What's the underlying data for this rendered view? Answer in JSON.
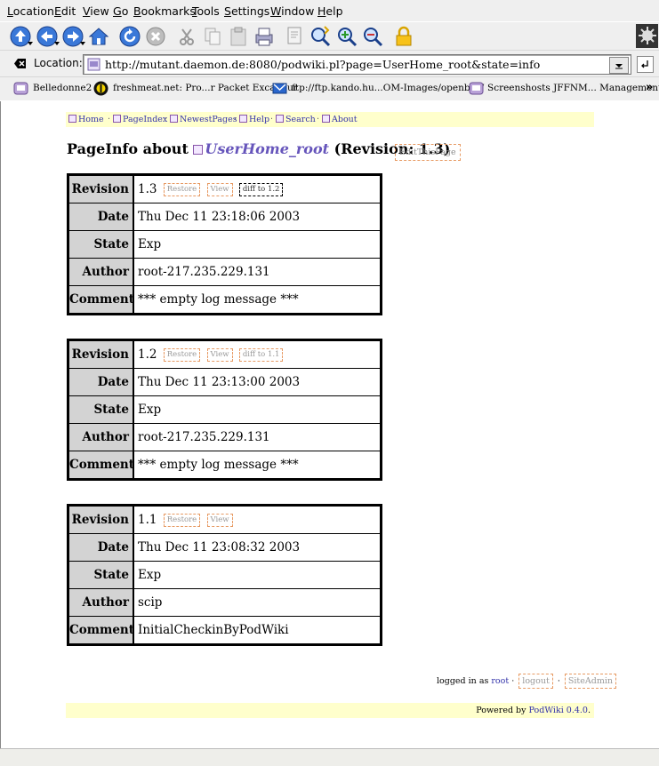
{
  "menu": [
    "Location",
    "Edit",
    "View",
    "Go",
    "Bookmarks",
    "Tools",
    "Settings",
    "Window",
    "Help"
  ],
  "location": {
    "label": "Location:",
    "url": "http://mutant.daemon.de:8080/podwiki.pl?page=UserHome_root&state=info"
  },
  "bookmarks": [
    "Belledonne2",
    "freshmeat.net: Pro...r Packet Excalibur",
    "ftp://ftp.kando.hu...OM-Images/openbsd/",
    "Screenshosts JFFNM... Management Sy"
  ],
  "nav": [
    "Home",
    "PageIndex",
    "NewestPages",
    "Help",
    "Search",
    "About"
  ],
  "heading": {
    "prefix": "PageInfo about",
    "page": "UserHome_root",
    "suffix": "(Revision: 1.3)",
    "edit_button": "EditThisPage"
  },
  "labels": {
    "revision": "Revision",
    "date": "Date",
    "state": "State",
    "author": "Author",
    "comment": "Comment"
  },
  "revisions": [
    {
      "revision": "1.3",
      "restore": "Restore",
      "view": "View",
      "diff": "diff to 1.2",
      "date": "Thu Dec 11 23:18:06 2003",
      "state": "Exp",
      "author": "root-217.235.229.131",
      "comment": "*** empty log message ***"
    },
    {
      "revision": "1.2",
      "restore": "Restore",
      "view": "View",
      "diff": "diff to 1.1",
      "date": "Thu Dec 11 23:13:00 2003",
      "state": "Exp",
      "author": "root-217.235.229.131",
      "comment": "*** empty log message ***"
    },
    {
      "revision": "1.1",
      "restore": "Restore",
      "view": "View",
      "date": "Thu Dec 11 23:08:32 2003",
      "state": "Exp",
      "author": "scip",
      "comment": "InitialCheckinByPodWiki"
    }
  ],
  "login": {
    "prefix": "logged in as",
    "user": "root",
    "logout": "logout",
    "siteadmin": "SiteAdmin"
  },
  "footer": {
    "prefix": "Powered by",
    "link": "PodWiki 0.4.0",
    "suffix": "."
  }
}
